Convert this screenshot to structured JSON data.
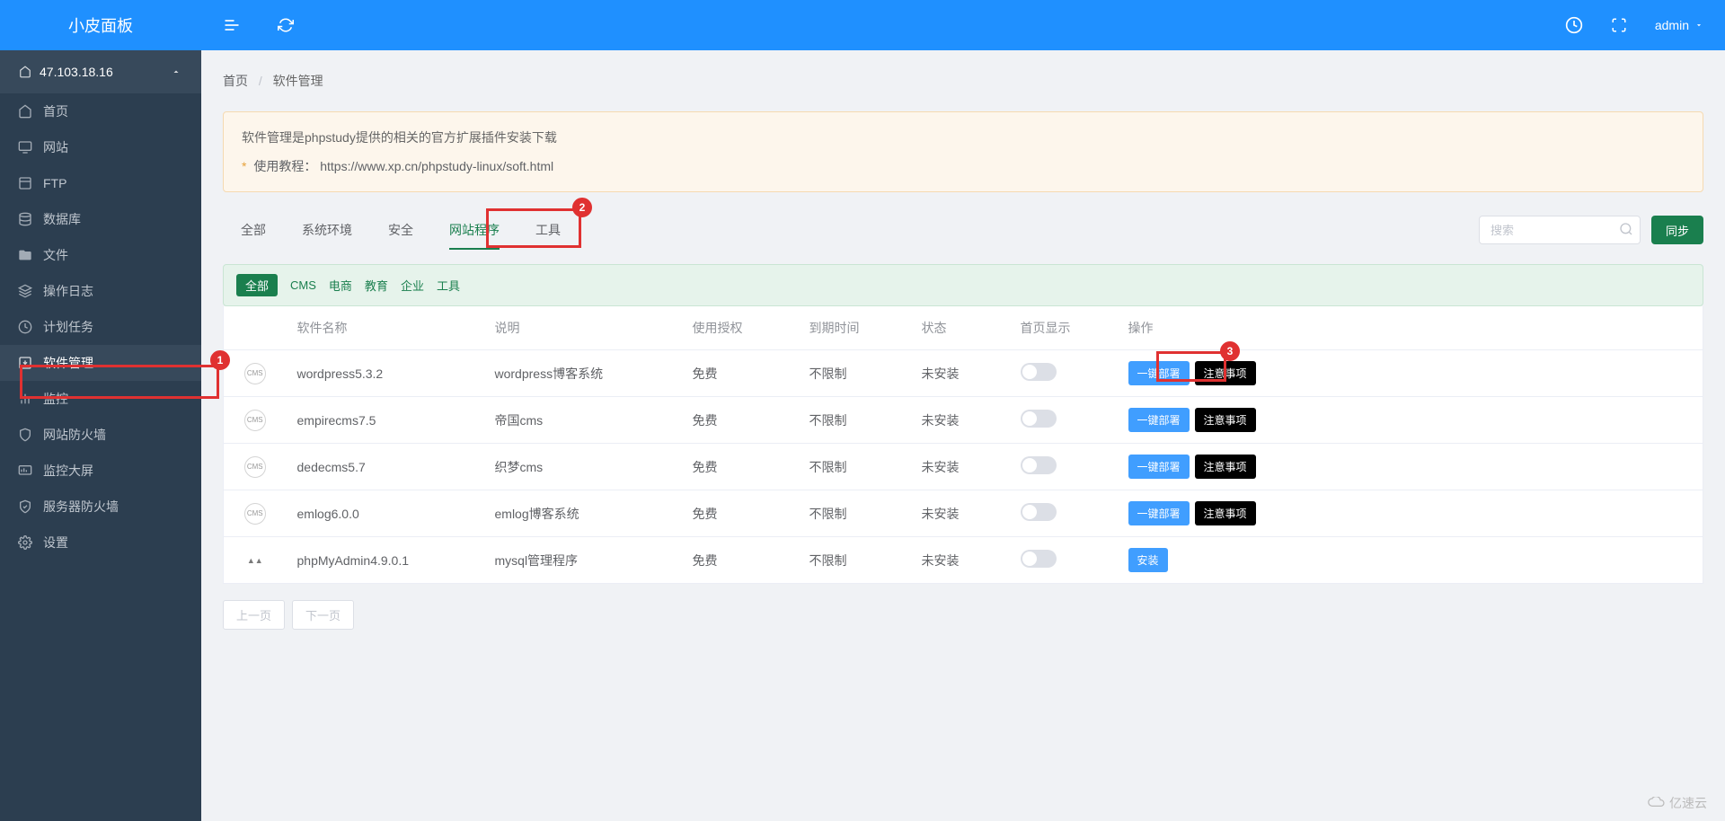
{
  "brand": "小皮面板",
  "server_ip": "47.103.18.16",
  "user": "admin",
  "breadcrumb": {
    "home": "首页",
    "current": "软件管理"
  },
  "sidebar": {
    "items": [
      {
        "label": "首页",
        "icon": "home"
      },
      {
        "label": "网站",
        "icon": "monitor"
      },
      {
        "label": "FTP",
        "icon": "ftp"
      },
      {
        "label": "数据库",
        "icon": "database"
      },
      {
        "label": "文件",
        "icon": "folder"
      },
      {
        "label": "操作日志",
        "icon": "layers"
      },
      {
        "label": "计划任务",
        "icon": "clock"
      },
      {
        "label": "软件管理",
        "icon": "download",
        "active": true
      },
      {
        "label": "监控",
        "icon": "chart"
      },
      {
        "label": "网站防火墙",
        "icon": "shield"
      },
      {
        "label": "监控大屏",
        "icon": "screen"
      },
      {
        "label": "服务器防火墙",
        "icon": "shield2"
      },
      {
        "label": "设置",
        "icon": "gear"
      }
    ]
  },
  "alert": {
    "title": "软件管理是phpstudy提供的相关的官方扩展插件安装下载",
    "tutorial_label": "使用教程：",
    "tutorial_url": "https://www.xp.cn/phpstudy-linux/soft.html"
  },
  "tabs": [
    "全部",
    "系统环境",
    "安全",
    "网站程序",
    "工具"
  ],
  "active_tab": "网站程序",
  "search_placeholder": "搜索",
  "sync_label": "同步",
  "filters": [
    "全部",
    "CMS",
    "电商",
    "教育",
    "企业",
    "工具"
  ],
  "active_filter": "全部",
  "table": {
    "headers": [
      "",
      "软件名称",
      "说明",
      "使用授权",
      "到期时间",
      "状态",
      "首页显示",
      "操作"
    ],
    "rows": [
      {
        "icon": "cms",
        "name": "wordpress5.3.2",
        "desc": "wordpress博客系统",
        "license": "免费",
        "expire": "不限制",
        "status": "未安装",
        "actions": [
          "一键部署",
          "注意事项"
        ]
      },
      {
        "icon": "cms",
        "name": "empirecms7.5",
        "desc": "帝国cms",
        "license": "免费",
        "expire": "不限制",
        "status": "未安装",
        "actions": [
          "一键部署",
          "注意事项"
        ]
      },
      {
        "icon": "cms",
        "name": "dedecms5.7",
        "desc": "织梦cms",
        "license": "免费",
        "expire": "不限制",
        "status": "未安装",
        "actions": [
          "一键部署",
          "注意事项"
        ]
      },
      {
        "icon": "cms",
        "name": "emlog6.0.0",
        "desc": "emlog博客系统",
        "license": "免费",
        "expire": "不限制",
        "status": "未安装",
        "actions": [
          "一键部署",
          "注意事项"
        ]
      },
      {
        "icon": "pma",
        "name": "phpMyAdmin4.9.0.1",
        "desc": "mysql管理程序",
        "license": "免费",
        "expire": "不限制",
        "status": "未安装",
        "actions": [
          "安装"
        ]
      }
    ]
  },
  "pagination": {
    "prev": "上一页",
    "next": "下一页"
  },
  "watermark": "亿速云"
}
